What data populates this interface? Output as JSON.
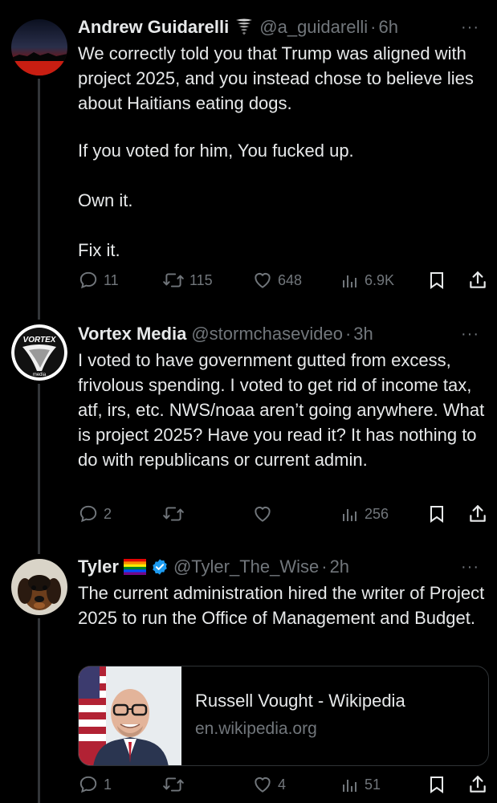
{
  "tweets": [
    {
      "name": "Andrew Guidarelli",
      "handle": "@a_guidarelli",
      "time": "6h",
      "paragraphs": [
        "We correctly told you that Trump was aligned with project 2025, and you instead chose to believe lies about Haitians eating dogs.",
        "If you voted for him, You fucked up.",
        "Own it.",
        "Fix it."
      ],
      "replies": "11",
      "retweets": "115",
      "likes": "648",
      "views": "6.9K"
    },
    {
      "name": "Vortex Media",
      "handle": "@stormchasevideo",
      "time": "3h",
      "avatar_text_top": "VORTEX",
      "avatar_text_bottom": "media",
      "paragraphs": [
        "I voted to have government gutted from excess, frivolous spending. I voted to get rid of income tax, atf, irs, etc.  NWS/noaa aren’t going anywhere. What is project 2025? Have you read it?  It has nothing to do with republicans or current admin."
      ],
      "replies": "2",
      "retweets": "",
      "likes": "",
      "views": "256"
    },
    {
      "name": "Tyler",
      "handle": "@Tyler_The_Wise",
      "time": "2h",
      "paragraphs": [
        "The current administration hired the writer of Project 2025 to run the Office of Management and Budget."
      ],
      "card": {
        "title": "Russell Vought - Wikipedia",
        "domain": "en.wikipedia.org"
      },
      "replies": "1",
      "retweets": "",
      "likes": "4",
      "views": "51"
    }
  ],
  "more_label": "···",
  "dot": "·",
  "icons": {
    "reply": "reply-icon",
    "retweet": "retweet-icon",
    "like": "heart-icon",
    "views": "views-icon",
    "bookmark": "bookmark-icon",
    "share": "share-icon",
    "verified": "verified-badge-icon",
    "pride_flag": "rainbow-flag-icon",
    "tornado": "tornado-emoji-icon"
  },
  "colors": {
    "background": "#000000",
    "text": "#e7e9ea",
    "secondary": "#71767b",
    "verified": "#1d9bf0",
    "divider": "#2f3336"
  }
}
